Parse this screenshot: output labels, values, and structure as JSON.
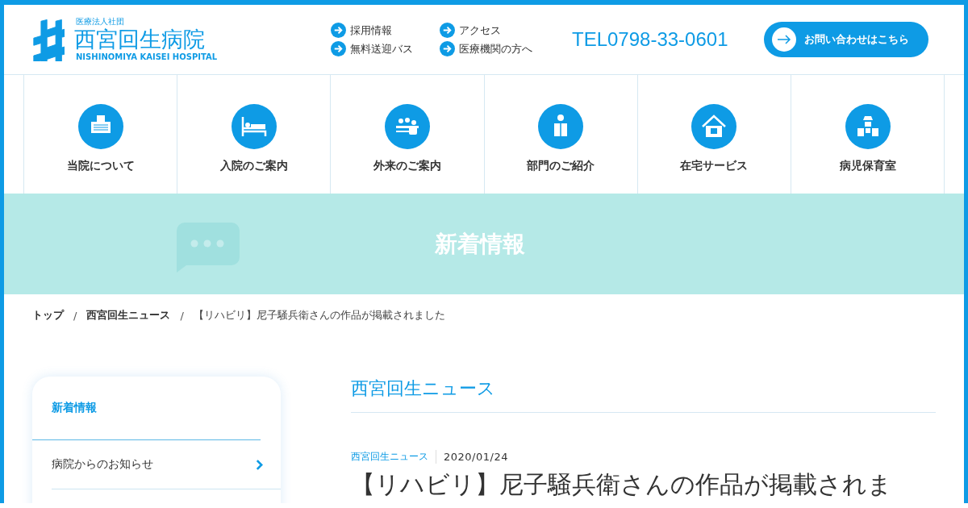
{
  "header": {
    "logo": {
      "corporation": "医療法人社団",
      "name": "西宮回生病院",
      "name_en": "NISHINOMIYA KAISEI HOSPITAL"
    },
    "links": [
      {
        "label": "採用情報"
      },
      {
        "label": "アクセス"
      },
      {
        "label": "無料送迎バス"
      },
      {
        "label": "医療機関の方へ"
      }
    ],
    "tel": "TEL0798-33-0601",
    "contact_button": "お問い合わせはこちら"
  },
  "nav": [
    {
      "label": "当院について"
    },
    {
      "label": "入院のご案内"
    },
    {
      "label": "外来のご案内"
    },
    {
      "label": "部門のご紹介"
    },
    {
      "label": "在宅サービス"
    },
    {
      "label": "病児保育室"
    }
  ],
  "banner": {
    "title": "新着情報"
  },
  "breadcrumb": [
    {
      "kind": "link",
      "label": "トップ"
    },
    {
      "kind": "separator",
      "label": "/"
    },
    {
      "kind": "link",
      "label": "西宮回生ニュース"
    },
    {
      "kind": "separator",
      "label": "/"
    },
    {
      "kind": "current",
      "label": "【リハビリ】尼子騒兵衛さんの作品が掲載されました"
    }
  ],
  "sidebar": {
    "items": [
      {
        "label": "新着情報",
        "selected": true
      },
      {
        "label": "病院からのお知らせ",
        "selected": false
      }
    ]
  },
  "article": {
    "section_title": "西宮回生ニュース",
    "category": "西宮回生ニュース",
    "date": "2020/01/24",
    "title": "【リハビリ】尼子騒兵衛さんの作品が掲載されま"
  }
}
